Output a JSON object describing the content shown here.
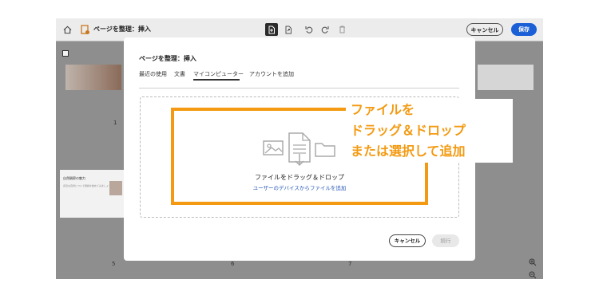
{
  "topbar": {
    "title": "ページを整理：挿入",
    "cancel_label": "キャンセル",
    "save_label": "保存"
  },
  "thumbnails": {
    "page_numbers": [
      "1",
      "5",
      "6",
      "7"
    ],
    "thumb_text_1": "自然観察の魅力",
    "thumb_text_2": "身近な自然について観察を始めてみましょう"
  },
  "dialog": {
    "title": "ページを整理：挿入",
    "tabs": [
      {
        "label": "最近の使用"
      },
      {
        "label": "文書"
      },
      {
        "label": "マイコンピューター"
      },
      {
        "label": "アカウントを追加"
      }
    ],
    "active_tab": "マイコンピューター",
    "drop_label": "ファイルをドラッグ＆ドロップ",
    "drop_link": "ユーザーのデバイスからファイルを追加",
    "cancel_label": "キャンセル",
    "continue_label": "続行"
  },
  "annotation": {
    "lines": [
      "ファイルを",
      "ドラッグ＆ドロップ",
      "または選択して追加"
    ],
    "color": "#f39a12"
  },
  "colors": {
    "accent": "#1b5fd6",
    "highlight": "#f39a12",
    "link": "#2557b8"
  }
}
